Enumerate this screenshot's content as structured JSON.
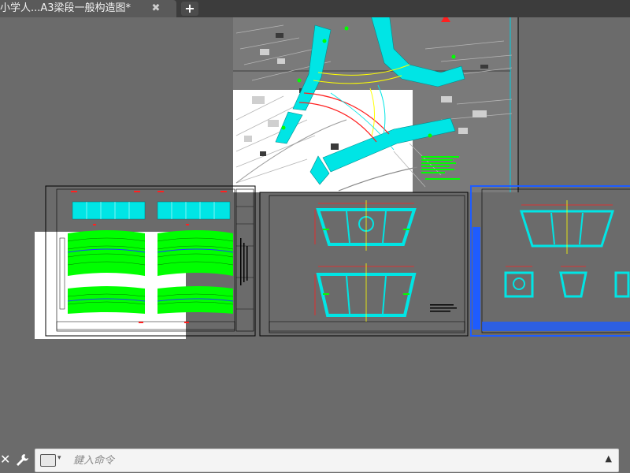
{
  "tabs": [
    {
      "label": "小学人...A3梁段一般构造图*",
      "close_glyph": "✖"
    }
  ],
  "new_tab_glyph": "+",
  "command_line": {
    "placeholder": "鍵入命令",
    "close_glyph": "✕",
    "history_glyph": "▲",
    "prompt_caret": "▾"
  },
  "icons": [
    "close-icon",
    "wrench-icon",
    "command-prompt-icon",
    "history-arrow-icon",
    "north-arrow-icon"
  ],
  "colors": {
    "canvas": "#6b6b6b",
    "sheet_border": "#000000",
    "cyan": "#00e5e5",
    "green": "#00ff00",
    "red": "#ff2020",
    "yellow": "#ffff00",
    "blue": "#1e5cff"
  }
}
